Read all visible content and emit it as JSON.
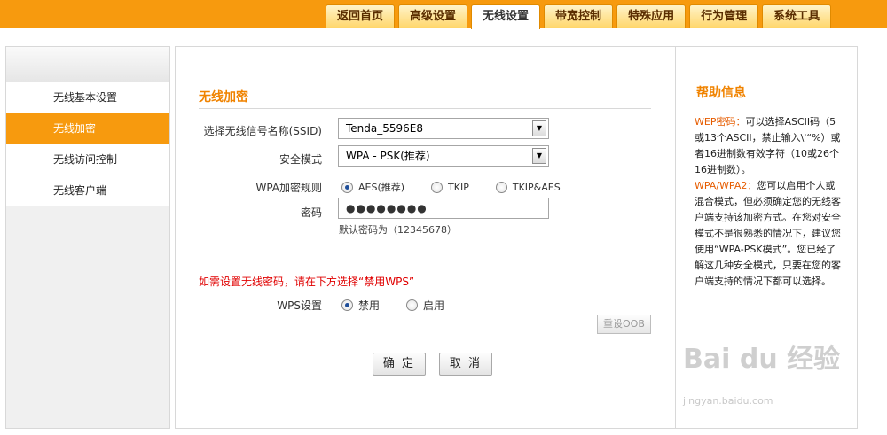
{
  "tabs": [
    "返回首页",
    "高级设置",
    "无线设置",
    "带宽控制",
    "特殊应用",
    "行为管理",
    "系统工具"
  ],
  "sidebar": {
    "items": [
      "无线基本设置",
      "无线加密",
      "无线访问控制",
      "无线客户端"
    ]
  },
  "form": {
    "section_title": "无线加密",
    "ssid_label": "选择无线信号名称(SSID)",
    "ssid_value": "Tenda_5596E8",
    "security_label": "安全模式",
    "security_value": "WPA - PSK(推荐)",
    "wpa_rule_label": "WPA加密规则",
    "wpa_options": [
      "AES(推荐)",
      "TKIP",
      "TKIP&AES"
    ],
    "password_label": "密码",
    "password_value": "●●●●●●●●",
    "password_hint": "默认密码为（12345678）",
    "wps_warning": "如需设置无线密码，请在下方选择“禁用WPS”",
    "wps_label": "WPS设置",
    "wps_options": [
      "禁用",
      "启用"
    ],
    "reset_oob_label": "重设OOB",
    "ok_label": "确 定",
    "cancel_label": "取 消"
  },
  "help": {
    "title": "帮助信息",
    "wep_key": "WEP密码：",
    "wep_text": "可以选择ASCII码（5或13个ASCII，禁止输入\\'“%）或者16进制数有效字符（10或26个16进制数）。",
    "wpa_key": "WPA/WPA2：",
    "wpa_text": "您可以启用个人或混合模式，但必须确定您的无线客户端支持该加密方式。在您对安全模式不是很熟悉的情况下，建议您使用“WPA-PSK模式”。您已经了解这几种安全模式，只要在您的客户端支持的情况下都可以选择。"
  },
  "watermark": {
    "main": "Bai du 经验",
    "sub": "jingyan.baidu.com"
  },
  "colors": {
    "accent": "#f79a0e",
    "title": "#f08300",
    "warning": "#e00000"
  }
}
